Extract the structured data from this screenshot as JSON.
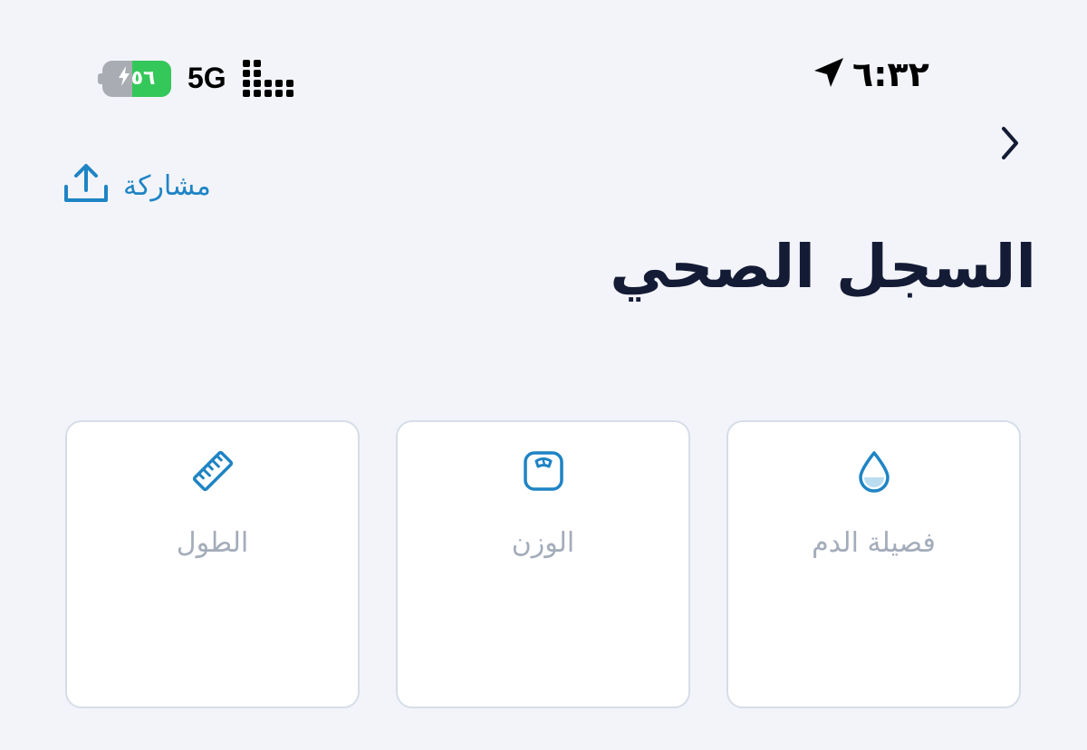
{
  "status_bar": {
    "time": "٦:٣٢",
    "network": "5G",
    "battery_level": "٥٦",
    "battery_percent": 56,
    "battery_charging": true,
    "location_icon": "location-arrow-icon",
    "signal_icon": "signal-bars-icon"
  },
  "nav": {
    "back_icon": "chevron-right-icon",
    "share_label": "مشاركة",
    "share_icon": "share-upload-icon"
  },
  "page": {
    "title": "السجل الصحي"
  },
  "cards": [
    {
      "label": "فصيلة الدم",
      "icon": "blood-drop-icon"
    },
    {
      "label": "الوزن",
      "icon": "weight-scale-icon"
    },
    {
      "label": "الطول",
      "icon": "ruler-icon"
    }
  ],
  "colors": {
    "background": "#f2f4f9",
    "accent": "#1f84c4",
    "title": "#141b35",
    "card_label": "#a3acba",
    "card_border": "#d6dde8",
    "battery_green": "#34c759"
  }
}
